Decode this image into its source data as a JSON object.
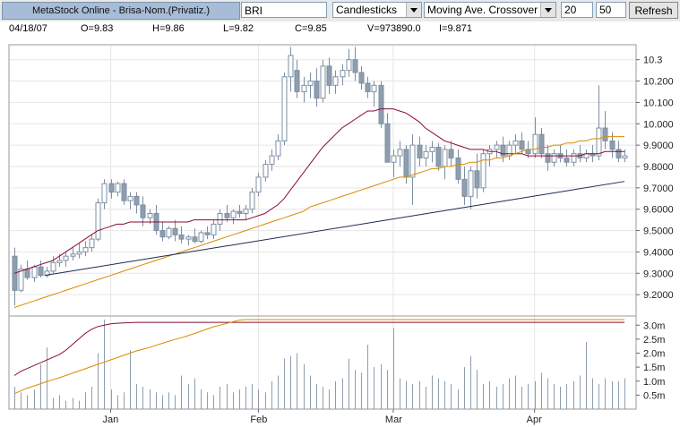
{
  "toolbar": {
    "title": "MetaStock Online - Brisa-Nom.(Privatiz.)",
    "symbol": "BRI",
    "chart_type": "Candlesticks",
    "study": "Moving Ave. Crossover",
    "param1": "20",
    "param2": "50",
    "refresh_label": "Refresh"
  },
  "info": {
    "date": "04/18/07",
    "open": "O=9.83",
    "high": "H=9.86",
    "low": "L=9.82",
    "close": "C=9.85",
    "volume": "V=973890.0",
    "indicator": "I=9.871"
  },
  "colors": {
    "up_candle": "#ffffff",
    "down_candle": "#8e9eae",
    "candle_outline": "#7d8fa3",
    "ma_fast": "#8b0a36",
    "ma_slow": "#d88c00",
    "trendline": "#1a2a4a",
    "volume_bar": "#8e9eae"
  },
  "chart_data": [
    {
      "type": "candlestick",
      "title": "",
      "xlabel": "",
      "ylabel": "",
      "ylim": [
        9.1,
        10.37
      ],
      "y_ticks": [
        "9.2000",
        "9.3000",
        "9.4000",
        "9.5000",
        "9.6000",
        "9.7000",
        "9.8000",
        "9.9000",
        "10.000",
        "10.100",
        "10.200",
        "10.3"
      ],
      "y_tick_values": [
        9.2,
        9.3,
        9.4,
        9.5,
        9.6,
        9.7,
        9.8,
        9.9,
        10.0,
        10.1,
        10.2,
        10.3
      ],
      "x_ticks": [
        "Jan",
        "Feb",
        "Mar",
        "Apr"
      ],
      "x_tick_bar_index": [
        15,
        38,
        59,
        81
      ],
      "candles": [
        [
          9.38,
          9.42,
          9.15,
          9.22
        ],
        [
          9.22,
          9.34,
          9.21,
          9.32
        ],
        [
          9.32,
          9.36,
          9.27,
          9.28
        ],
        [
          9.28,
          9.34,
          9.26,
          9.33
        ],
        [
          9.33,
          9.36,
          9.28,
          9.29
        ],
        [
          9.29,
          9.33,
          9.28,
          9.31
        ],
        [
          9.31,
          9.38,
          9.3,
          9.35
        ],
        [
          9.35,
          9.39,
          9.33,
          9.36
        ],
        [
          9.36,
          9.4,
          9.33,
          9.38
        ],
        [
          9.38,
          9.42,
          9.36,
          9.39
        ],
        [
          9.39,
          9.44,
          9.37,
          9.4
        ],
        [
          9.4,
          9.45,
          9.38,
          9.42
        ],
        [
          9.42,
          9.48,
          9.4,
          9.46
        ],
        [
          9.46,
          9.65,
          9.45,
          9.63
        ],
        [
          9.63,
          9.74,
          9.6,
          9.72
        ],
        [
          9.72,
          9.74,
          9.65,
          9.68
        ],
        [
          9.68,
          9.73,
          9.66,
          9.72
        ],
        [
          9.72,
          9.74,
          9.62,
          9.64
        ],
        [
          9.64,
          9.68,
          9.6,
          9.66
        ],
        [
          9.66,
          9.68,
          9.58,
          9.62
        ],
        [
          9.62,
          9.66,
          9.52,
          9.56
        ],
        [
          9.56,
          9.6,
          9.53,
          9.58
        ],
        [
          9.58,
          9.62,
          9.48,
          9.5
        ],
        [
          9.5,
          9.54,
          9.45,
          9.47
        ],
        [
          9.47,
          9.52,
          9.46,
          9.51
        ],
        [
          9.51,
          9.55,
          9.45,
          9.48
        ],
        [
          9.48,
          9.52,
          9.44,
          9.46
        ],
        [
          9.46,
          9.48,
          9.43,
          9.47
        ],
        [
          9.47,
          9.51,
          9.44,
          9.45
        ],
        [
          9.45,
          9.5,
          9.44,
          9.49
        ],
        [
          9.49,
          9.52,
          9.46,
          9.48
        ],
        [
          9.48,
          9.55,
          9.46,
          9.53
        ],
        [
          9.53,
          9.6,
          9.5,
          9.58
        ],
        [
          9.58,
          9.62,
          9.54,
          9.56
        ],
        [
          9.56,
          9.6,
          9.53,
          9.59
        ],
        [
          9.59,
          9.62,
          9.56,
          9.58
        ],
        [
          9.58,
          9.62,
          9.55,
          9.6
        ],
        [
          9.6,
          9.7,
          9.58,
          9.68
        ],
        [
          9.68,
          9.77,
          9.66,
          9.75
        ],
        [
          9.75,
          9.83,
          9.73,
          9.81
        ],
        [
          9.81,
          9.88,
          9.78,
          9.85
        ],
        [
          9.85,
          9.95,
          9.83,
          9.92
        ],
        [
          9.92,
          10.24,
          9.9,
          10.22
        ],
        [
          10.22,
          10.36,
          10.15,
          10.32
        ],
        [
          10.25,
          10.3,
          10.12,
          10.15
        ],
        [
          10.15,
          10.22,
          10.1,
          10.18
        ],
        [
          10.18,
          10.24,
          10.12,
          10.2
        ],
        [
          10.2,
          10.26,
          10.08,
          10.12
        ],
        [
          10.12,
          10.3,
          10.1,
          10.27
        ],
        [
          10.27,
          10.31,
          10.14,
          10.18
        ],
        [
          10.18,
          10.25,
          10.14,
          10.22
        ],
        [
          10.22,
          10.28,
          10.18,
          10.25
        ],
        [
          10.25,
          10.35,
          10.22,
          10.3
        ],
        [
          10.3,
          10.36,
          10.2,
          10.24
        ],
        [
          10.24,
          10.27,
          10.16,
          10.19
        ],
        [
          10.19,
          10.22,
          10.12,
          10.15
        ],
        [
          10.15,
          10.2,
          10.08,
          10.18
        ],
        [
          10.18,
          10.2,
          9.98,
          10.0
        ],
        [
          10.0,
          10.05,
          9.82,
          9.82
        ],
        [
          9.82,
          9.88,
          9.75,
          9.85
        ],
        [
          9.85,
          9.92,
          9.8,
          9.88
        ],
        [
          9.88,
          9.9,
          9.72,
          9.75
        ],
        [
          9.75,
          9.95,
          9.62,
          9.9
        ],
        [
          9.9,
          9.94,
          9.8,
          9.84
        ],
        [
          9.84,
          9.9,
          9.8,
          9.87
        ],
        [
          9.87,
          9.92,
          9.82,
          9.89
        ],
        [
          9.89,
          9.91,
          9.78,
          9.8
        ],
        [
          9.8,
          9.9,
          9.74,
          9.88
        ],
        [
          9.88,
          9.92,
          9.8,
          9.84
        ],
        [
          9.84,
          9.88,
          9.72,
          9.74
        ],
        [
          9.74,
          9.8,
          9.62,
          9.66
        ],
        [
          9.66,
          9.8,
          9.6,
          9.78
        ],
        [
          9.78,
          9.86,
          9.65,
          9.7
        ],
        [
          9.7,
          9.88,
          9.68,
          9.86
        ],
        [
          9.86,
          9.9,
          9.8,
          9.88
        ],
        [
          9.88,
          9.92,
          9.84,
          9.9
        ],
        [
          9.9,
          9.94,
          9.82,
          9.85
        ],
        [
          9.85,
          9.92,
          9.83,
          9.9
        ],
        [
          9.9,
          9.95,
          9.86,
          9.92
        ],
        [
          9.92,
          9.96,
          9.86,
          9.88
        ],
        [
          9.88,
          9.92,
          9.84,
          9.86
        ],
        [
          9.86,
          10.03,
          9.84,
          9.95
        ],
        [
          9.95,
          9.98,
          9.84,
          9.86
        ],
        [
          9.86,
          9.9,
          9.78,
          9.82
        ],
        [
          9.82,
          9.88,
          9.8,
          9.86
        ],
        [
          9.86,
          9.9,
          9.82,
          9.84
        ],
        [
          9.84,
          9.88,
          9.8,
          9.82
        ],
        [
          9.82,
          9.88,
          9.8,
          9.86
        ],
        [
          9.86,
          9.9,
          9.82,
          9.84
        ],
        [
          9.84,
          9.88,
          9.82,
          9.86
        ],
        [
          9.86,
          9.9,
          9.82,
          9.85
        ],
        [
          9.85,
          10.18,
          9.83,
          9.98
        ],
        [
          9.98,
          10.06,
          9.88,
          9.92
        ],
        [
          9.92,
          9.96,
          9.84,
          9.88
        ],
        [
          9.88,
          9.92,
          9.82,
          9.84
        ],
        [
          9.84,
          9.88,
          9.82,
          9.85
        ]
      ],
      "series": [
        {
          "name": "",
          "values": [
            9.3,
            9.31,
            9.32,
            9.33,
            9.34,
            9.35,
            9.36,
            9.38,
            9.4,
            9.42,
            9.44,
            9.46,
            9.48,
            9.5,
            9.51,
            9.52,
            9.53,
            9.53,
            9.54,
            9.54,
            9.54,
            9.54,
            9.54,
            9.54,
            9.54,
            9.54,
            9.54,
            9.54,
            9.55,
            9.55,
            9.55,
            9.55,
            9.55,
            9.55,
            9.55,
            9.55,
            9.55,
            9.56,
            9.57,
            9.58,
            9.6,
            9.62,
            9.65,
            9.69,
            9.73,
            9.77,
            9.81,
            9.85,
            9.89,
            9.92,
            9.95,
            9.98,
            10.0,
            10.02,
            10.04,
            10.06,
            10.06,
            10.07,
            10.07,
            10.07,
            10.06,
            10.05,
            10.03,
            10.01,
            9.98,
            9.96,
            9.94,
            9.92,
            9.91,
            9.9,
            9.89,
            9.88,
            9.88,
            9.88,
            9.87,
            9.87,
            9.86,
            9.86,
            9.86,
            9.86,
            9.85,
            9.85,
            9.85,
            9.85,
            9.85,
            9.85,
            9.85,
            9.85,
            9.85,
            9.86,
            9.86,
            9.86,
            9.87,
            9.87,
            9.87,
            9.87
          ]
        },
        {
          "name": "",
          "values": [
            9.14,
            9.15,
            9.16,
            9.17,
            9.18,
            9.19,
            9.2,
            9.21,
            9.22,
            9.23,
            9.24,
            9.25,
            9.26,
            9.27,
            9.28,
            9.29,
            9.3,
            9.31,
            9.32,
            9.33,
            9.34,
            9.35,
            9.36,
            9.37,
            9.38,
            9.39,
            9.4,
            9.41,
            9.42,
            9.43,
            9.44,
            9.45,
            9.46,
            9.47,
            9.48,
            9.49,
            9.5,
            9.51,
            9.52,
            9.53,
            9.54,
            9.55,
            9.56,
            9.57,
            9.58,
            9.59,
            9.61,
            9.62,
            9.63,
            9.64,
            9.65,
            9.66,
            9.67,
            9.68,
            9.69,
            9.7,
            9.71,
            9.72,
            9.73,
            9.74,
            9.75,
            9.75,
            9.76,
            9.77,
            9.78,
            9.79,
            9.79,
            9.8,
            9.8,
            9.81,
            9.81,
            9.82,
            9.82,
            9.83,
            9.83,
            9.84,
            9.84,
            9.85,
            9.86,
            9.87,
            9.88,
            9.88,
            9.89,
            9.89,
            9.9,
            9.9,
            9.91,
            9.91,
            9.92,
            9.92,
            9.93,
            9.93,
            9.94,
            9.94,
            9.94,
            9.94
          ]
        },
        {
          "name": "",
          "line_points": [
            [
              0,
              9.29
            ],
            [
              95,
              9.73
            ]
          ]
        }
      ]
    },
    {
      "type": "bar",
      "title": "",
      "ylim": [
        0,
        3.2
      ],
      "y_ticks": [
        "3.0m",
        "2.5m",
        "2.0m",
        "1.5m",
        "1.0m",
        "0.5m"
      ],
      "y_tick_values": [
        3.0,
        2.5,
        2.0,
        1.5,
        1.0,
        0.5
      ],
      "values": [
        0.8,
        0.6,
        0.5,
        0.7,
        1.6,
        2.2,
        0.4,
        0.5,
        0.3,
        0.4,
        0.3,
        0.6,
        0.8,
        2.0,
        3.2,
        0.7,
        0.5,
        0.6,
        2.1,
        0.9,
        0.8,
        0.7,
        0.6,
        0.5,
        0.6,
        0.5,
        1.2,
        0.9,
        1.1,
        0.7,
        0.6,
        0.5,
        0.8,
        0.9,
        0.6,
        0.7,
        0.8,
        0.9,
        0.7,
        0.6,
        1.0,
        1.2,
        1.8,
        1.9,
        2.0,
        1.6,
        1.2,
        0.9,
        0.8,
        0.7,
        1.0,
        1.1,
        1.8,
        1.4,
        1.3,
        2.3,
        1.5,
        1.6,
        1.4,
        2.9,
        1.1,
        1.0,
        0.9,
        1.0,
        0.8,
        1.2,
        1.1,
        1.0,
        0.9,
        0.7,
        1.5,
        1.9,
        1.4,
        0.9,
        1.0,
        0.8,
        0.9,
        1.1,
        1.2,
        0.8,
        0.9,
        1.0,
        1.3,
        1.1,
        0.9,
        0.8,
        0.9,
        1.0,
        1.2,
        2.4,
        1.1,
        0.9,
        1.1,
        1.0,
        1.0,
        1.1
      ],
      "series": [
        {
          "name": "",
          "values": [
            1.2,
            1.35,
            1.45,
            1.55,
            1.65,
            1.75,
            1.85,
            1.95,
            2.1,
            2.3,
            2.5,
            2.7,
            2.85,
            2.95,
            3.0,
            3.05,
            3.07,
            3.08,
            3.09,
            3.1,
            3.1,
            3.1,
            3.1,
            3.1,
            3.1,
            3.1,
            3.1,
            3.1,
            3.1,
            3.1,
            3.1,
            3.1,
            3.1,
            3.1,
            3.1,
            3.1,
            3.1,
            3.1,
            3.1,
            3.1,
            3.1,
            3.1,
            3.1,
            3.1,
            3.1,
            3.1,
            3.1,
            3.1,
            3.1,
            3.1,
            3.1,
            3.1,
            3.1,
            3.1,
            3.1,
            3.1,
            3.1,
            3.1,
            3.1,
            3.1,
            3.1,
            3.1,
            3.1,
            3.1,
            3.1,
            3.1,
            3.1,
            3.1,
            3.1,
            3.1,
            3.1,
            3.1,
            3.1,
            3.1,
            3.1,
            3.1,
            3.1,
            3.1,
            3.1,
            3.1,
            3.1,
            3.1,
            3.1,
            3.1,
            3.1,
            3.1,
            3.1,
            3.1,
            3.1,
            3.1,
            3.1,
            3.1,
            3.1,
            3.1,
            3.1,
            3.1
          ]
        },
        {
          "name": "",
          "values": [
            0.55,
            0.65,
            0.75,
            0.82,
            0.9,
            0.98,
            1.05,
            1.12,
            1.2,
            1.28,
            1.36,
            1.44,
            1.52,
            1.6,
            1.68,
            1.76,
            1.84,
            1.92,
            2.0,
            2.08,
            2.14,
            2.2,
            2.28,
            2.35,
            2.42,
            2.49,
            2.55,
            2.62,
            2.7,
            2.78,
            2.86,
            2.94,
            3.0,
            3.06,
            3.12,
            3.18,
            3.2,
            3.2,
            3.2,
            3.2,
            3.2,
            3.2,
            3.2,
            3.2,
            3.2,
            3.2,
            3.2,
            3.2,
            3.2,
            3.2,
            3.2,
            3.2,
            3.2,
            3.2,
            3.2,
            3.2,
            3.2,
            3.2,
            3.2,
            3.2,
            3.2,
            3.2,
            3.2,
            3.2,
            3.2,
            3.2,
            3.2,
            3.2,
            3.2,
            3.2,
            3.2,
            3.2,
            3.2,
            3.2,
            3.2,
            3.2,
            3.2,
            3.2,
            3.2,
            3.2,
            3.2,
            3.2,
            3.2,
            3.2,
            3.2,
            3.2,
            3.2,
            3.2,
            3.2,
            3.2,
            3.2,
            3.2,
            3.2,
            3.2,
            3.2,
            3.2
          ]
        }
      ]
    }
  ]
}
